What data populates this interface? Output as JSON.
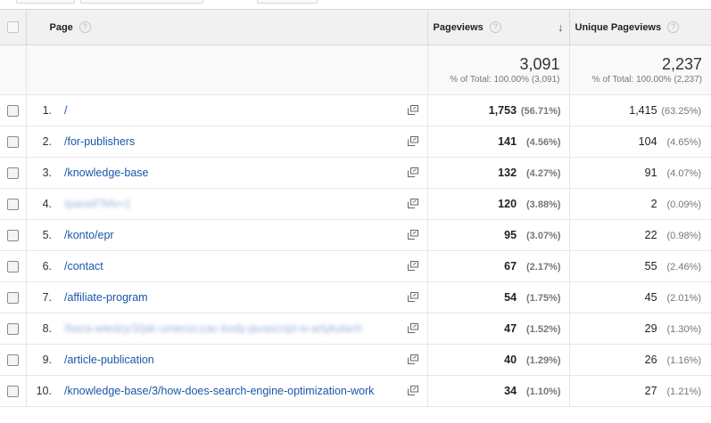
{
  "header": {
    "page_label": "Page",
    "pageviews_label": "Pageviews",
    "unique_pageviews_label": "Unique Pageviews",
    "help_glyph": "?",
    "sort_glyph": "↓"
  },
  "totals": {
    "pageviews": "3,091",
    "pageviews_sub": "% of Total: 100.00% (3,091)",
    "unique_pageviews": "2,237",
    "unique_pageviews_sub": "% of Total: 100.00% (2,237)"
  },
  "rows": [
    {
      "index": "1.",
      "page": "/",
      "pv": "1,753",
      "pv_pct": "(56.71%)",
      "upv": "1,415",
      "upv_pct": "(63.25%)"
    },
    {
      "index": "2.",
      "page": "/for-publishers",
      "pv": "141",
      "pv_pct": "(4.56%)",
      "upv": "104",
      "upv_pct": "(4.65%)"
    },
    {
      "index": "3.",
      "page": "/knowledge-base",
      "pv": "132",
      "pv_pct": "(4.27%)",
      "upv": "91",
      "upv_pct": "(4.07%)"
    },
    {
      "index": "4.",
      "page": "/panel/?kfv=1",
      "pv": "120",
      "pv_pct": "(3.88%)",
      "upv": "2",
      "upv_pct": "(0.09%)"
    },
    {
      "index": "5.",
      "page": "/konto/epr",
      "pv": "95",
      "pv_pct": "(3.07%)",
      "upv": "22",
      "upv_pct": "(0.98%)"
    },
    {
      "index": "6.",
      "page": "/contact",
      "pv": "67",
      "pv_pct": "(2.17%)",
      "upv": "55",
      "upv_pct": "(2.46%)"
    },
    {
      "index": "7.",
      "page": "/affiliate-program",
      "pv": "54",
      "pv_pct": "(1.75%)",
      "upv": "45",
      "upv_pct": "(2.01%)"
    },
    {
      "index": "8.",
      "page": "/baza-wiedzy/3/jak-umieszczac-kody-javascript-w-artykulach",
      "pv": "47",
      "pv_pct": "(1.52%)",
      "upv": "29",
      "upv_pct": "(1.30%)"
    },
    {
      "index": "9.",
      "page": "/article-publication",
      "pv": "40",
      "pv_pct": "(1.29%)",
      "upv": "26",
      "upv_pct": "(1.16%)"
    },
    {
      "index": "10.",
      "page": "/knowledge-base/3/how-does-search-engine-optimization-work",
      "pv": "34",
      "pv_pct": "(1.10%)",
      "upv": "27",
      "upv_pct": "(1.21%)"
    }
  ]
}
